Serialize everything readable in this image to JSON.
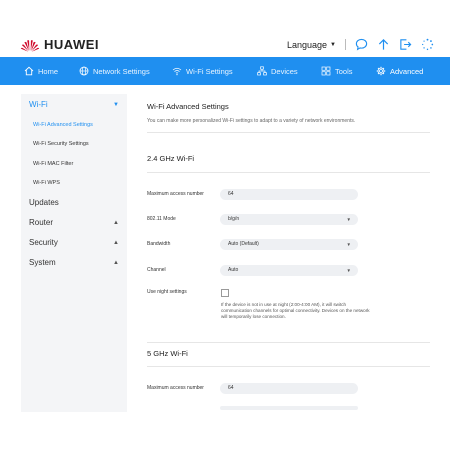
{
  "brand": {
    "name": "HUAWEI",
    "color": "#cf0a2c"
  },
  "accent_color": "#1f8ff0",
  "top_tools": {
    "language_label": "Language",
    "icons": [
      "chat-icon",
      "upload-icon",
      "logout-icon",
      "loading-icon"
    ]
  },
  "nav": {
    "home": "Home",
    "network_settings": "Network Settings",
    "wifi_settings": "Wi-Fi Settings",
    "devices": "Devices",
    "tools": "Tools",
    "advanced": "Advanced"
  },
  "sidebar": {
    "wifi": "Wi-Fi",
    "wifi_advanced": "Wi-Fi Advanced Settings",
    "wifi_security": "Wi-Fi Security Settings",
    "wifi_mac_filter": "Wi-Fi MAC Filter",
    "wifi_wps": "Wi-Fi WPS",
    "updates": "Updates",
    "router": "Router",
    "security": "Security",
    "system": "System"
  },
  "main": {
    "title": "Wi-Fi Advanced Settings",
    "description": "You can make more personalized Wi-Fi settings to adapt to a variety of network environments.",
    "section_24": {
      "title": "2.4 GHz Wi-Fi",
      "max_access_label": "Maximum access number",
      "max_access_value": "64",
      "mode_label": "802.11 Mode",
      "mode_value": "b/g/n",
      "bandwidth_label": "Bandwidth",
      "bandwidth_value": "Auto (Default)",
      "channel_label": "Channel",
      "channel_value": "Auto",
      "night_label": "Use night settings",
      "night_checked": false,
      "night_help": "If the device is not in use at night (2:00-4:00 AM), it will switch communication channels for optimal connectivity. Devices on the network will temporarily lose connection."
    },
    "section_5": {
      "title": "5 GHz Wi-Fi",
      "max_access_label": "Maximum access number",
      "max_access_value": "64"
    }
  }
}
